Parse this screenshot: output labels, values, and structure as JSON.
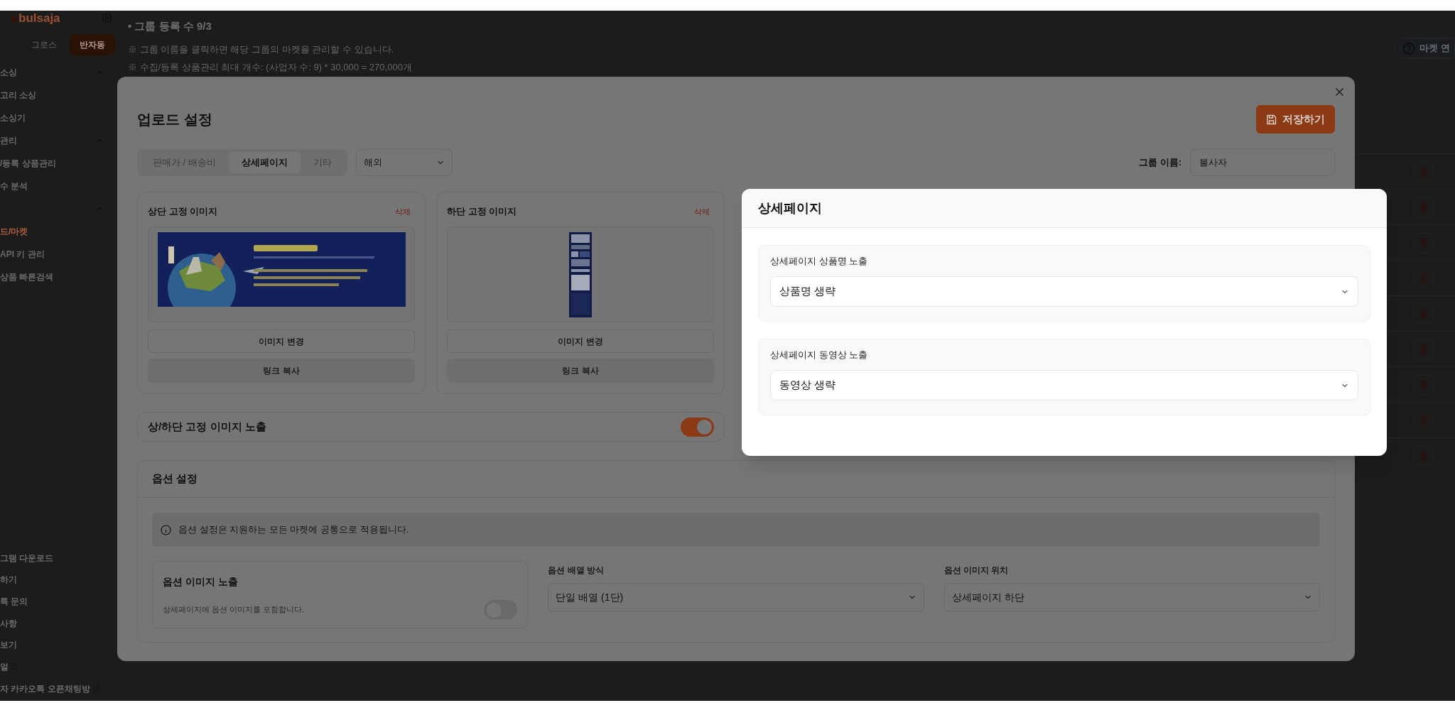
{
  "sidebar": {
    "logo": "bulsaja",
    "mode_tabs": [
      {
        "label": "그로스",
        "selected": false
      },
      {
        "label": "반자동",
        "selected": true
      }
    ],
    "items": [
      {
        "kind": "section",
        "label": "소싱"
      },
      {
        "kind": "link",
        "label": "고리 소싱",
        "selected": false
      },
      {
        "kind": "link",
        "label": "소싱기",
        "selected": false
      },
      {
        "kind": "section",
        "label": "관리"
      },
      {
        "kind": "link",
        "label": "/등록 상품관리",
        "selected": false
      },
      {
        "kind": "link",
        "label": "수 분석",
        "selected": false
      },
      {
        "kind": "section"
      },
      {
        "kind": "link",
        "label": "드/마켓",
        "selected": true
      },
      {
        "kind": "link",
        "label": "API 키 관리",
        "selected": false
      },
      {
        "kind": "link",
        "label": "상품 빠른검색",
        "selected": false
      }
    ],
    "bottom_items": [
      {
        "label": "그램 다운로드",
        "external": false
      },
      {
        "label": "하기",
        "external": false
      },
      {
        "label": "톡 문의",
        "external": false
      },
      {
        "label": "사항",
        "external": false
      },
      {
        "label": "보기",
        "external": false
      },
      {
        "label": "얼",
        "external": true
      },
      {
        "label": "자 카카오톡 오픈채팅방",
        "external": true
      }
    ]
  },
  "main": {
    "group_count": "• 그룹 등록 수 9/3",
    "notes": [
      "※ 그룹 이름을 클릭하면 해당 그룹의 마켓을 관리할 수 있습니다.",
      "※ 수집/등록 상품관리 최대 개수: (사업자 수: 9) * 30,000 = 270,000개"
    ],
    "help_button": "마켓 연"
  },
  "modal": {
    "title": "업로드 설정",
    "save_button": "저장하기",
    "tabs": [
      {
        "label": "판매가 / 배송비",
        "selected": false
      },
      {
        "label": "상세페이지",
        "selected": true
      },
      {
        "label": "기타",
        "selected": false
      }
    ],
    "region_select": "해외",
    "group_name_label": "그룹 이름:",
    "group_name_value": "불사자",
    "image_cards": [
      {
        "title": "상단 고정 이미지",
        "delete": "삭제",
        "change_button": "이미지 변경",
        "copy_button": "링크 복사"
      },
      {
        "title": "하단 고정 이미지",
        "delete": "삭제",
        "change_button": "이미지 변경",
        "copy_button": "링크 복사"
      }
    ],
    "fixed_image_toggle": {
      "label": "상/하단 고정 이미지 노출",
      "on": true
    },
    "options": {
      "title": "옵션 설정",
      "info": "옵션 설정은 지원하는 모든 마켓에 공통으로 적용됩니다.",
      "image_toggle": {
        "title": "옵션 이미지 노출",
        "description": "상세페이지에 옵션 이미지를 포함합니다.",
        "on": false
      },
      "selects": [
        {
          "label": "옵션 배열 방식",
          "value": "단일 배열 (1단)"
        },
        {
          "label": "옵션 이미지 위치",
          "value": "상세페이지 하단"
        }
      ]
    }
  },
  "popup": {
    "title": "상세페이지",
    "fields": [
      {
        "label": "상세페이지 상품명 노출",
        "value": "상품명 생략"
      },
      {
        "label": "상세페이지 동영상 노출",
        "value": "동영상 생략"
      }
    ]
  }
}
